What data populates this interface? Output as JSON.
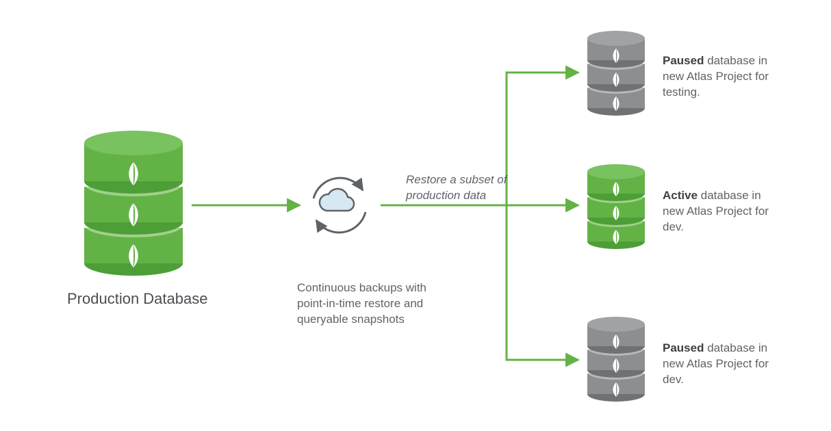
{
  "nodes": {
    "production": {
      "label": "Production Database"
    },
    "backup": {
      "label": "Continuous backups with point-in-time restore and queryable snapshots"
    },
    "arrowLabel": "Restore a subset of production data"
  },
  "targets": {
    "testing": {
      "statusWord": "Paused",
      "rest": " database in new Atlas Project for testing."
    },
    "devActive": {
      "statusWord": "Active",
      "rest": " database in new Atlas Project for dev."
    },
    "devPaused": {
      "statusWord": "Paused",
      "rest": " database in new Atlas Project for dev."
    }
  },
  "colors": {
    "green": "#63B245",
    "greenDark": "#4E9E38",
    "grey": "#8C8E90",
    "greyDark": "#6f7173",
    "cloudFill": "#D6E8F2",
    "stroke": "#5f6368"
  }
}
